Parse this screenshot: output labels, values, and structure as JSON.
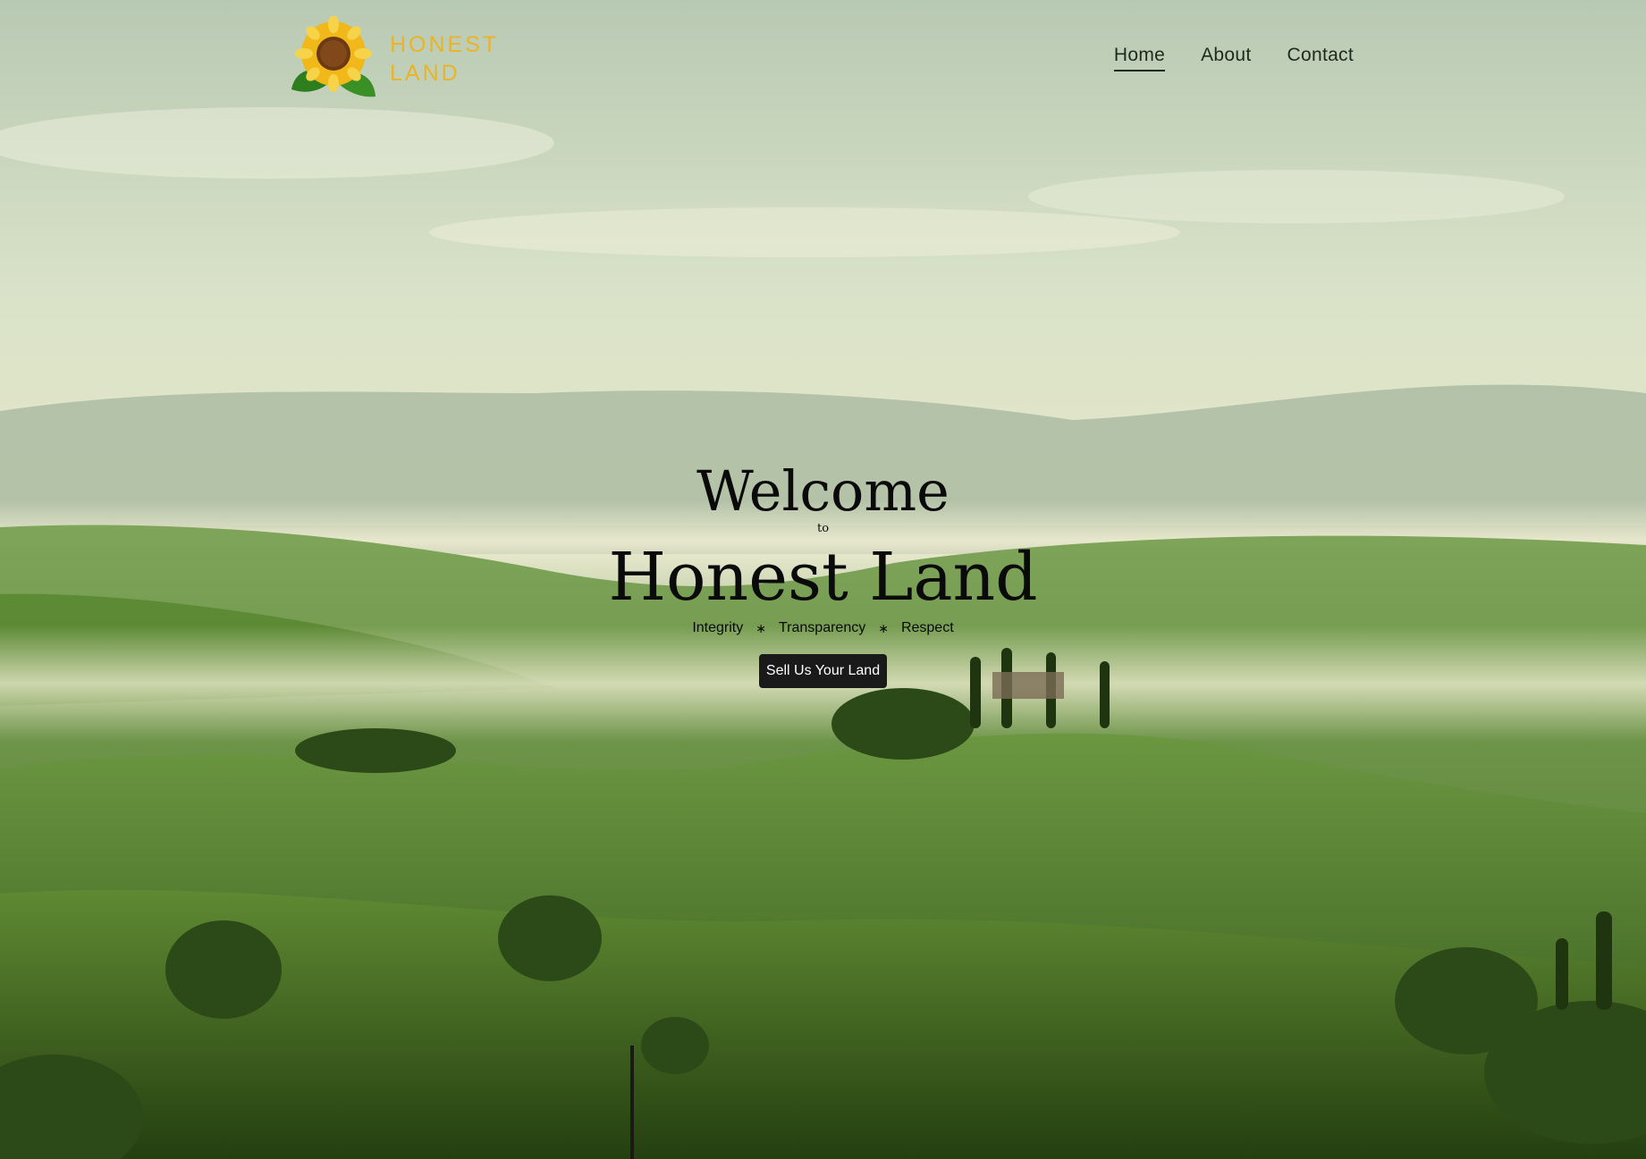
{
  "brand": {
    "line1": "HONEST",
    "line2": "LAND",
    "logo_icon": "sunflower-icon",
    "color": "#e9b42a"
  },
  "nav": {
    "items": [
      {
        "label": "Home",
        "active": true
      },
      {
        "label": "About",
        "active": false
      },
      {
        "label": "Contact",
        "active": false
      }
    ]
  },
  "hero": {
    "welcome": "Welcome",
    "to": "to",
    "title": "Honest Land",
    "values": [
      "Integrity",
      "Transparency",
      "Respect"
    ],
    "separator": "∗",
    "cta_label": "Sell Us Your Land"
  }
}
